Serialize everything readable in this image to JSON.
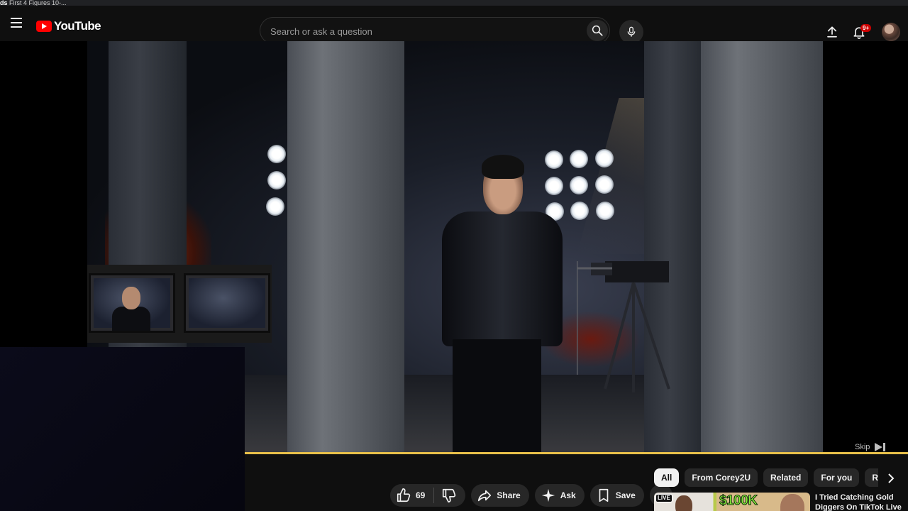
{
  "browser_tab": {
    "prefix": "ds",
    "title": "First 4 Figures 10-..."
  },
  "header": {
    "logo_text": "YouTube",
    "search_placeholder": "Search or ask a question",
    "notification_count": "9+",
    "icons": [
      "menu-icon",
      "search-icon",
      "mic-icon",
      "upload-icon",
      "bell-icon",
      "avatar"
    ]
  },
  "player": {
    "skip_label": "Skip",
    "progress_color": "#e8c04a"
  },
  "actions": {
    "like_count": "69",
    "share_label": "Share",
    "ask_label": "Ask",
    "save_label": "Save"
  },
  "chips": {
    "items": [
      "All",
      "From Corey2U",
      "Related",
      "For you",
      "Recently uploaded"
    ],
    "active_index": 0
  },
  "recommendation": {
    "badge": "LIVE",
    "thumb_text": "$100K",
    "title": "I Tried Catching Gold Diggers On TikTok Live"
  },
  "colors": {
    "background": "#0f0f0f",
    "brand_red": "#ff0000",
    "badge_red": "#cc0000",
    "pill_bg": "#272727"
  }
}
